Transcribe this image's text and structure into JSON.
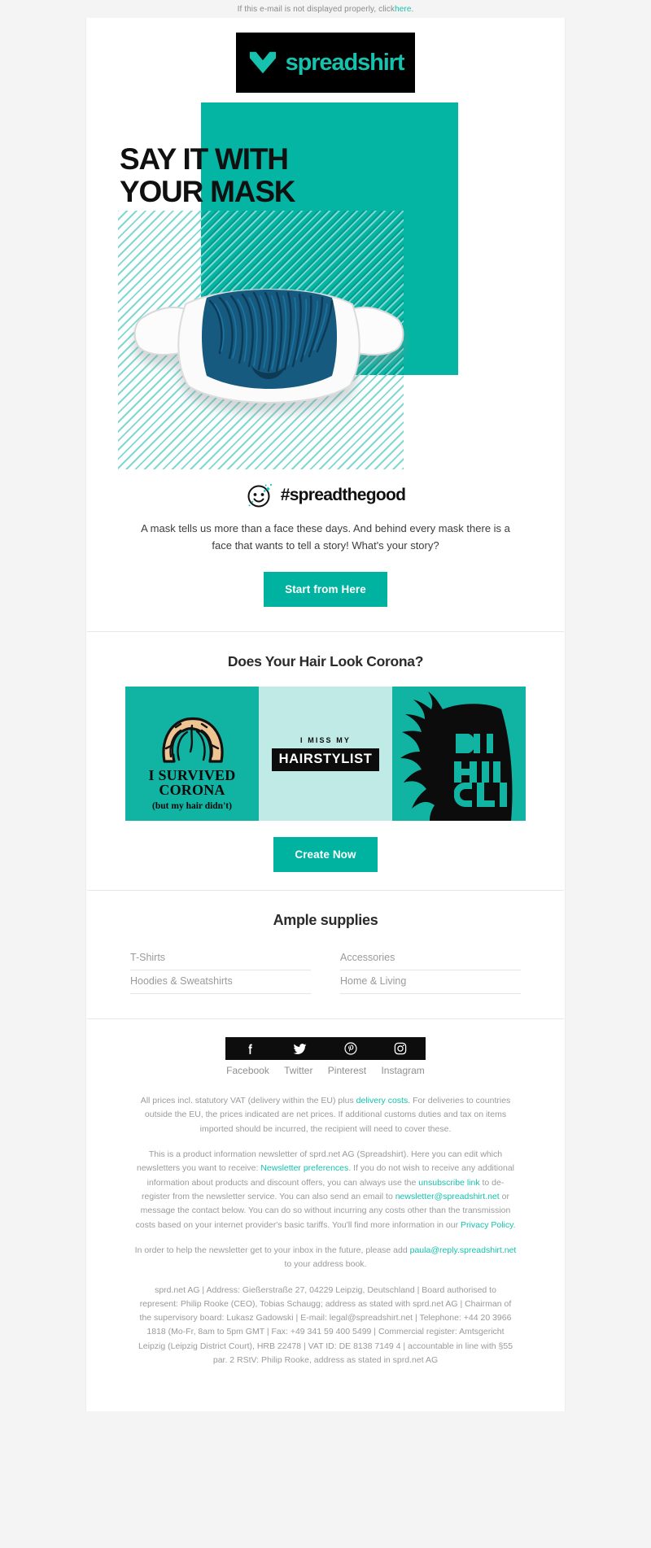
{
  "preheader": {
    "text_before": "If this e-mail is not displayed properly, click ",
    "link": "here",
    "text_after": "."
  },
  "brand": {
    "name": "spreadshirt",
    "logo_icon": "heart-logo-icon",
    "accent_color": "#16c1ad",
    "teal": "#05b5a4",
    "button_color": "#00b2a0"
  },
  "hero": {
    "title_line1": "SAY IT WITH",
    "title_line2": "YOUR MASK",
    "image_alt": "face-mask-with-beard-print"
  },
  "intro": {
    "smiley_icon": "smiley-wink-icon",
    "hashtag": "#spreadthegood",
    "copy": "A mask tells us more than a face these days. And behind every mask there is a face that wants to tell a story! What's your story?",
    "cta_label": "Start from Here"
  },
  "hair_section": {
    "title": "Does Your Hair Look Corona?",
    "tiles": [
      {
        "id": "i-survived-corona",
        "bg": "#11b3a3",
        "line1": "I SURVIVED",
        "line2": "CORONA",
        "line3": "(but my hair didn't)",
        "art": "hair-arch-illustration"
      },
      {
        "id": "i-miss-my-hairstylist",
        "bg": "#bfeae5",
        "line1": "I MISS MY",
        "line2": "HAIRSTYLIST"
      },
      {
        "id": "bad-hair-club",
        "bg": "#11b3a3",
        "line1": "BAD",
        "line2": "HAIR",
        "line3": "CLUB",
        "art": "spiky-hair-silhouette"
      }
    ],
    "cta_label": "Create Now"
  },
  "supplies": {
    "title": "Ample supplies",
    "links": [
      "T-Shirts",
      "Accessories",
      "Hoodies & Sweatshirts",
      "Home & Living"
    ]
  },
  "social": {
    "items": [
      {
        "label": "Facebook",
        "icon": "facebook-icon"
      },
      {
        "label": "Twitter",
        "icon": "twitter-icon"
      },
      {
        "label": "Pinterest",
        "icon": "pinterest-icon"
      },
      {
        "label": "Instagram",
        "icon": "instagram-icon"
      }
    ]
  },
  "legal": {
    "p1_a": "All prices incl. statutory VAT (delivery within the EU) plus ",
    "p1_link": "delivery costs",
    "p1_b": ". For deliveries to countries outside the EU, the prices indicated are net prices. If additional customs duties and tax on items imported should be incurred, the recipient will need to cover these.",
    "p2_a": "This is a product information newsletter of sprd.net AG (Spreadshirt). Here you can edit which newsletters you want to receive: ",
    "p2_link1": "Newsletter preferences",
    "p2_b": ". If you do not wish to receive any additional information about products and discount offers, you can always use the ",
    "p2_link2": "unsubscribe link",
    "p2_c": " to de-register from the newsletter service. You can also send an email to ",
    "p2_link3": "newsletter@spreadshirt.net",
    "p2_d": " or message the contact below. You can do so without incurring any costs other than the transmission costs based on your internet provider's basic tariffs. You'll find more information in our ",
    "p2_link4": "Privacy Policy",
    "p2_e": ".",
    "p3_a": "In order to help the newsletter get to your inbox in the future, please add ",
    "p3_link": "paula@reply.spreadshirt.net",
    "p3_b": " to your address book.",
    "p4": "sprd.net AG | Address: Gießerstraße 27, 04229 Leipzig, Deutschland | Board authorised to represent: Philip Rooke (CEO), Tobias Schaugg; address as stated with sprd.net AG | Chairman of the supervisory board: Lukasz Gadowski | E-mail: legal@spreadshirt.net | Telephone: +44 20 3966 1818 (Mo-Fr, 8am to 5pm GMT | Fax: +49 341 59 400 5499 | Commercial register: Amtsgericht Leipzig (Leipzig District Court), HRB 22478 | VAT ID: DE 8138 7149 4 | accountable in line with §55 par. 2 RStV: Philip Rooke, address as stated in sprd.net AG"
  }
}
